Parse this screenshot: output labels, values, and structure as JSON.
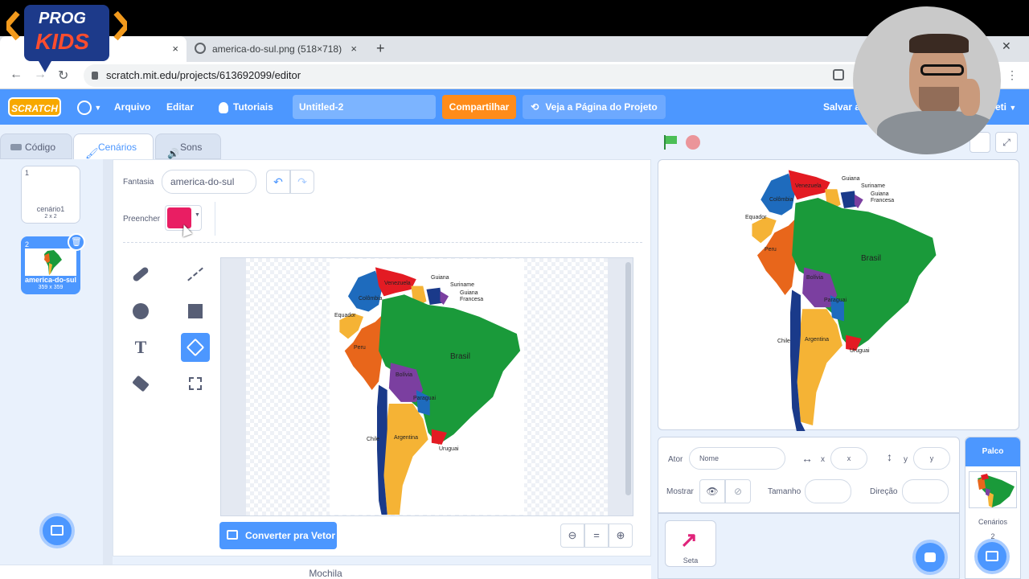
{
  "browser": {
    "tabs": [
      {
        "title": "",
        "close": "×"
      },
      {
        "title": "america-do-sul.png (518×718)",
        "close": "×"
      }
    ],
    "new_tab": "+",
    "url": "scratch.mit.edu/projects/613692099/editor",
    "window_close": "✕"
  },
  "menu": {
    "logo": "SCRATCH",
    "arquivo": "Arquivo",
    "editar": "Editar",
    "tutoriais": "Tutoriais",
    "project_title": "Untitled-2",
    "share": "Compartilhar",
    "see_project": "Veja a Página do Projeto",
    "save": "Salvar ag",
    "user": "eti"
  },
  "editor_tabs": {
    "code": "Código",
    "costumes": "Cenários",
    "sounds": "Sons"
  },
  "backdrops": [
    {
      "index": "1",
      "name": "cenário1",
      "size": "2 x 2"
    },
    {
      "index": "2",
      "name": "america-do-sul",
      "size": "359 x 359"
    }
  ],
  "paint": {
    "costume_label": "Fantasia",
    "costume_name": "america-do-sul",
    "fill_label": "Preencher",
    "fill_color": "#e91e63",
    "convert_button": "Converter pra Vetor",
    "zoom_reset": "="
  },
  "backpack": "Mochila",
  "map_labels": {
    "venezuela": "Venezuela",
    "colombia": "Colômbia",
    "guiana": "Guiana",
    "suriname": "Suriname",
    "guiana_francesa_1": "Guiana",
    "guiana_francesa_2": "Francesa",
    "equador": "Equador",
    "peru": "Peru",
    "brasil": "Brasil",
    "bolivia": "Bolívia",
    "paraguai": "Paraguai",
    "chile": "Chile",
    "argentina": "Argentina",
    "uruguai": "Uruguai"
  },
  "sprite_info": {
    "ator_label": "Ator",
    "name_placeholder": "Nome",
    "x_label": "x",
    "x_placeholder": "x",
    "y_label": "y",
    "y_placeholder": "y",
    "show_label": "Mostrar",
    "size_label": "Tamanho",
    "direction_label": "Direção"
  },
  "sprites": [
    {
      "name": "Seta"
    }
  ],
  "stage_panel": {
    "title": "Palco",
    "backdrops_label": "Cenários",
    "backdrops_count": "2"
  },
  "overlay_logo": {
    "line1": "PROG",
    "line2": "KIDS"
  },
  "colors": {
    "scratch_blue": "#4c97ff",
    "share_orange": "#ff8c1a",
    "flag_green": "#4cbf56",
    "stop_red": "#ec5959"
  }
}
